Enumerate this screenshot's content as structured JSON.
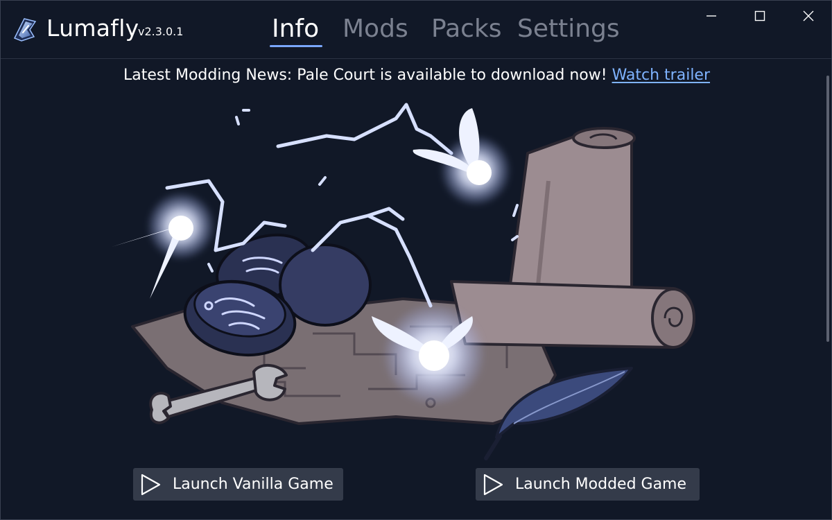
{
  "app": {
    "name": "Lumafly",
    "version": "v2.3.0.1"
  },
  "tabs": [
    {
      "label": "Info",
      "active": true
    },
    {
      "label": "Mods",
      "active": false
    },
    {
      "label": "Packs",
      "active": false
    },
    {
      "label": "Settings",
      "active": false
    }
  ],
  "window_controls": {
    "minimize_icon": "minimize-icon",
    "maximize_icon": "maximize-icon",
    "close_icon": "close-icon"
  },
  "news": {
    "text": "Latest Modding News: Pale Court is available to download now! ",
    "link_label": "Watch trailer"
  },
  "illustration": {
    "subject": "glowing wisps over map, mod pods, scroll, wrench and quill"
  },
  "actions": {
    "launch_vanilla": "Launch Vanilla Game",
    "launch_modded": "Launch Modded Game",
    "play_icon": "play-icon"
  },
  "colors": {
    "background": "#111827",
    "tab_inactive": "#7b8190",
    "tab_active": "#ffffff",
    "accent": "#7aa7ff",
    "link": "#7fb3ff",
    "button_bg": "#343b4a"
  }
}
